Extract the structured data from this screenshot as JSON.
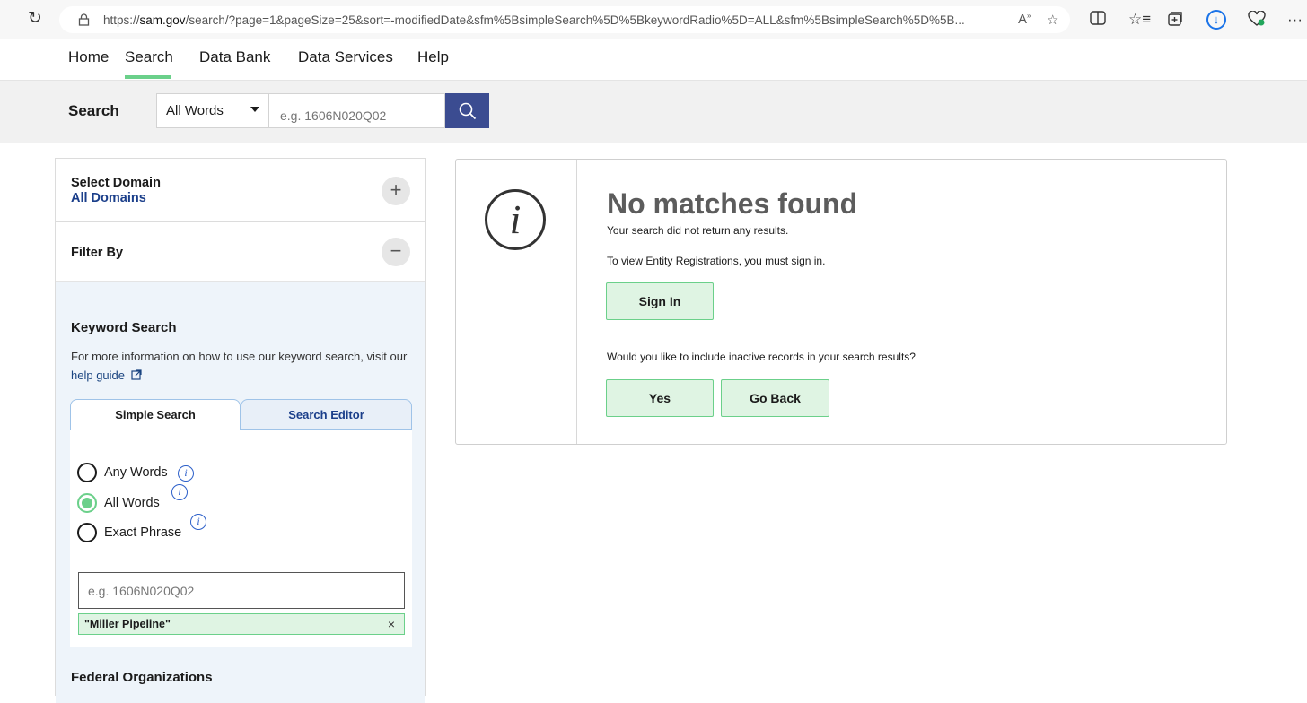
{
  "browser": {
    "url_prefix": "https://",
    "url_host": "sam.gov",
    "url_rest": "/search/?page=1&pageSize=25&sort=-modifiedDate&sfm%5BsimpleSearch%5D%5BkeywordRadio%5D=ALL&sfm%5BsimpleSearch%5D%5B..."
  },
  "nav": {
    "items": [
      "Home",
      "Search",
      "Data Bank",
      "Data Services",
      "Help"
    ],
    "active": "Search"
  },
  "search": {
    "label": "Search",
    "scope": "All Words",
    "placeholder": "e.g. 1606N020Q02"
  },
  "sidebar": {
    "domain_title": "Select Domain",
    "domain_value": "All Domains",
    "filter_title": "Filter By",
    "keyword_title": "Keyword Search",
    "keyword_desc": "For more information on how to use our keyword search, visit our",
    "help_link": "help guide",
    "tabs": [
      "Simple Search",
      "Search Editor"
    ],
    "radios": [
      {
        "label": "Any Words",
        "checked": false
      },
      {
        "label": "All Words",
        "checked": true
      },
      {
        "label": "Exact Phrase",
        "checked": false
      }
    ],
    "keyword_placeholder": "e.g. 1606N020Q02",
    "chip": "\"Miller Pipeline\"",
    "chip_close": "×",
    "federal_title": "Federal Organizations"
  },
  "result": {
    "title": "No matches found",
    "subtitle": "Your search did not return any results.",
    "sign_in_text": "To view Entity Registrations, you must sign in.",
    "sign_in_button": "Sign In",
    "inactive_question": "Would you like to include inactive records in your search results?",
    "yes_button": "Yes",
    "back_button": "Go Back"
  },
  "colors": {
    "accent_green": "#6bd08a",
    "search_button": "#3b4c91",
    "link_blue": "#1a3e8a",
    "filter_bg": "#eef4fa"
  }
}
